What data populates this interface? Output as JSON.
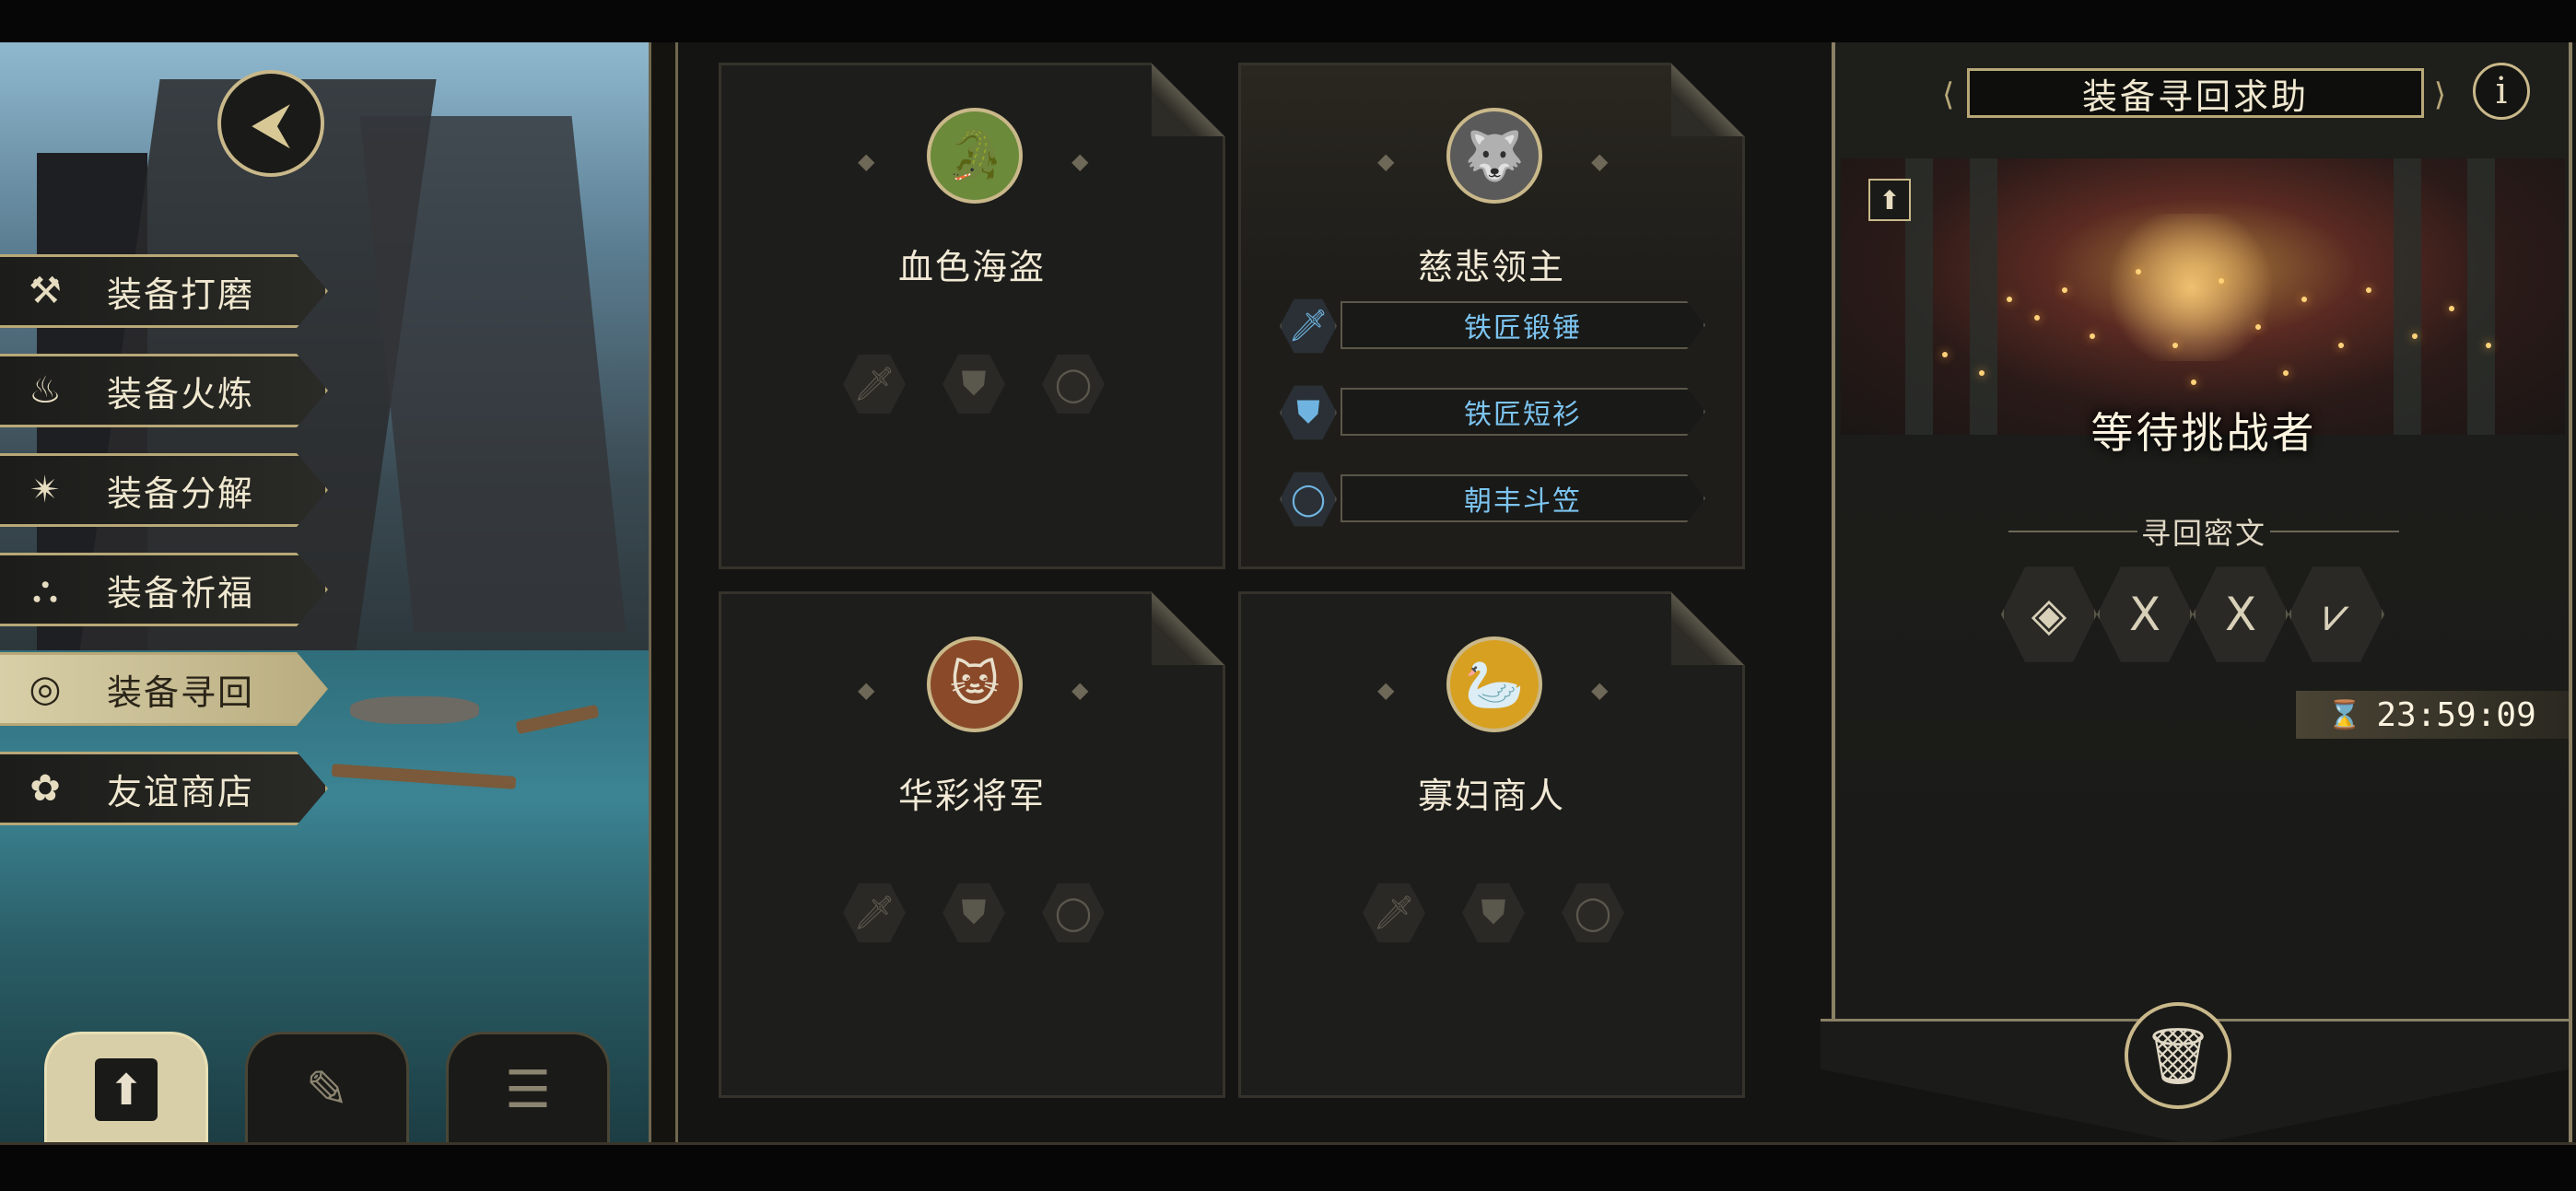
{
  "left_menu": {
    "items": [
      {
        "label": "装备打磨",
        "icon": "hammer-icon",
        "glyph": "⚒"
      },
      {
        "label": "装备火炼",
        "icon": "flame-icon",
        "glyph": "♨"
      },
      {
        "label": "装备分解",
        "icon": "disassemble-icon",
        "glyph": "✴"
      },
      {
        "label": "装备祈福",
        "icon": "pray-icon",
        "glyph": "⛬"
      },
      {
        "label": "装备寻回",
        "icon": "target-icon",
        "glyph": "◎"
      },
      {
        "label": "友谊商店",
        "icon": "fox-icon",
        "glyph": "✿"
      }
    ],
    "active_index": 4,
    "back_glyph": "⮜"
  },
  "bottom_tabs": [
    {
      "name": "upload-tab",
      "glyph": "⬆",
      "active": true
    },
    {
      "name": "feather-tab",
      "glyph": "✎",
      "active": false
    },
    {
      "name": "list-tab",
      "glyph": "☰",
      "active": false
    }
  ],
  "board": {
    "cards": [
      {
        "name": "血色海盗",
        "portrait_glyph": "🐊",
        "portrait_color": "#6b8a3a",
        "lit": false,
        "items": [],
        "empty_slots": [
          "🗡",
          "⛊",
          "◯"
        ]
      },
      {
        "name": "慈悲领主",
        "portrait_glyph": "🐺",
        "portrait_color": "#5a5a5a",
        "lit": true,
        "items": [
          {
            "label": "铁匠锻锤",
            "icon": "sword-icon",
            "glyph": "🗡"
          },
          {
            "label": "铁匠短衫",
            "icon": "armor-icon",
            "glyph": "⛊"
          },
          {
            "label": "朝丰斗笠",
            "icon": "ring-icon",
            "glyph": "◯"
          }
        ],
        "empty_slots": []
      },
      {
        "name": "华彩将军",
        "portrait_glyph": "🐱",
        "portrait_color": "#8a4a2a",
        "lit": false,
        "items": [],
        "empty_slots": [
          "🗡",
          "⛊",
          "◯"
        ]
      },
      {
        "name": "寡妇商人",
        "portrait_glyph": "🦢",
        "portrait_color": "#d8a020",
        "lit": false,
        "items": [],
        "empty_slots": [
          "🗡",
          "⛊",
          "◯"
        ]
      }
    ],
    "item_color": "#7cc4f0"
  },
  "right_panel": {
    "title": "装备寻回求助",
    "info_glyph": "i",
    "status": "等待挑战者",
    "cipher_label": "寻回密文",
    "runes": [
      "◈",
      "ꓫ",
      "ꓫ",
      "⩗"
    ],
    "timer": "23:59:09",
    "upload_glyph": "⬆",
    "trash_glyph": "🗑"
  }
}
